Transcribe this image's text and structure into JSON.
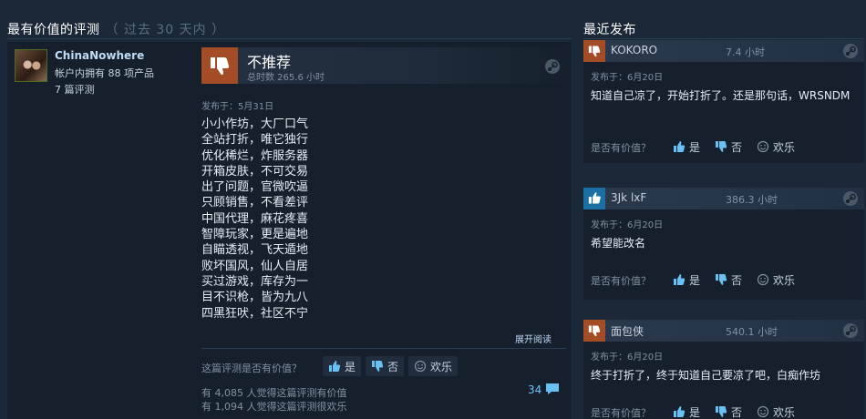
{
  "most_helpful": {
    "title": "最有价值的评测",
    "subtitle": "（ 过去 30 天内 ）"
  },
  "recent": {
    "title": "最近发布"
  },
  "main_review": {
    "author": {
      "name": "ChinaNowhere",
      "products": "帐户内拥有 88 项产品",
      "reviews": "7 篇评测"
    },
    "verdict": "不推荐",
    "hours": "总时数 265.6 小时",
    "posted": "发布于：5月31日",
    "lines": [
      "小小作坊，大厂口气",
      "全站打折，唯它独行",
      "优化稀烂，炸服务器",
      "开箱皮肤，不可交易",
      "出了问题，官微吹逼",
      "只顾销售，不看差评",
      "中国代理，麻花疼喜",
      "智障玩家，更是遍地",
      "自瞄透视，飞天遁地",
      "败坏国风，仙人自居",
      "买过游戏，库存为一",
      "目不识枪，皆为九八",
      "四黑狂吠，社区不宁"
    ],
    "expand": "展开阅读",
    "helpful_question": "这篇评测是否有价值？",
    "yes": "是",
    "no": "否",
    "funny": "欢乐",
    "stat_helpful": "有 4,085 人觉得这篇评测有价值",
    "stat_funny": "有 1,094 人觉得这篇评测很欢乐",
    "comment_count": "34"
  },
  "recent_reviews": [
    {
      "name": "KOKORO",
      "time": "7.4 小时",
      "verdict": "negative",
      "posted": "发布于：6月20日",
      "text": "知道自己凉了，开始打折了。还是那句话，WRSNDM",
      "question": "是否有价值？",
      "yes": "是",
      "no": "否",
      "funny": "欢乐"
    },
    {
      "name": "3Jk lxF",
      "time": "386.3 小时",
      "verdict": "positive",
      "posted": "发布于：6月20日",
      "text": "希望能改名",
      "question": "是否有价值？",
      "yes": "是",
      "no": "否",
      "funny": "欢乐"
    },
    {
      "name": "面包侠",
      "time": "540.1 小时",
      "verdict": "negative",
      "posted": "发布于：6月20日",
      "text": "终于打折了，终于知道自己要凉了吧，白痴作坊",
      "question": "是否有价值？",
      "yes": "是",
      "no": "否",
      "funny": "欢乐"
    }
  ],
  "colors": {
    "background": "#1b2838",
    "card": "#16202d",
    "negative": "#a34c25",
    "positive": "#1a6fa3",
    "link": "#67c1f5"
  }
}
